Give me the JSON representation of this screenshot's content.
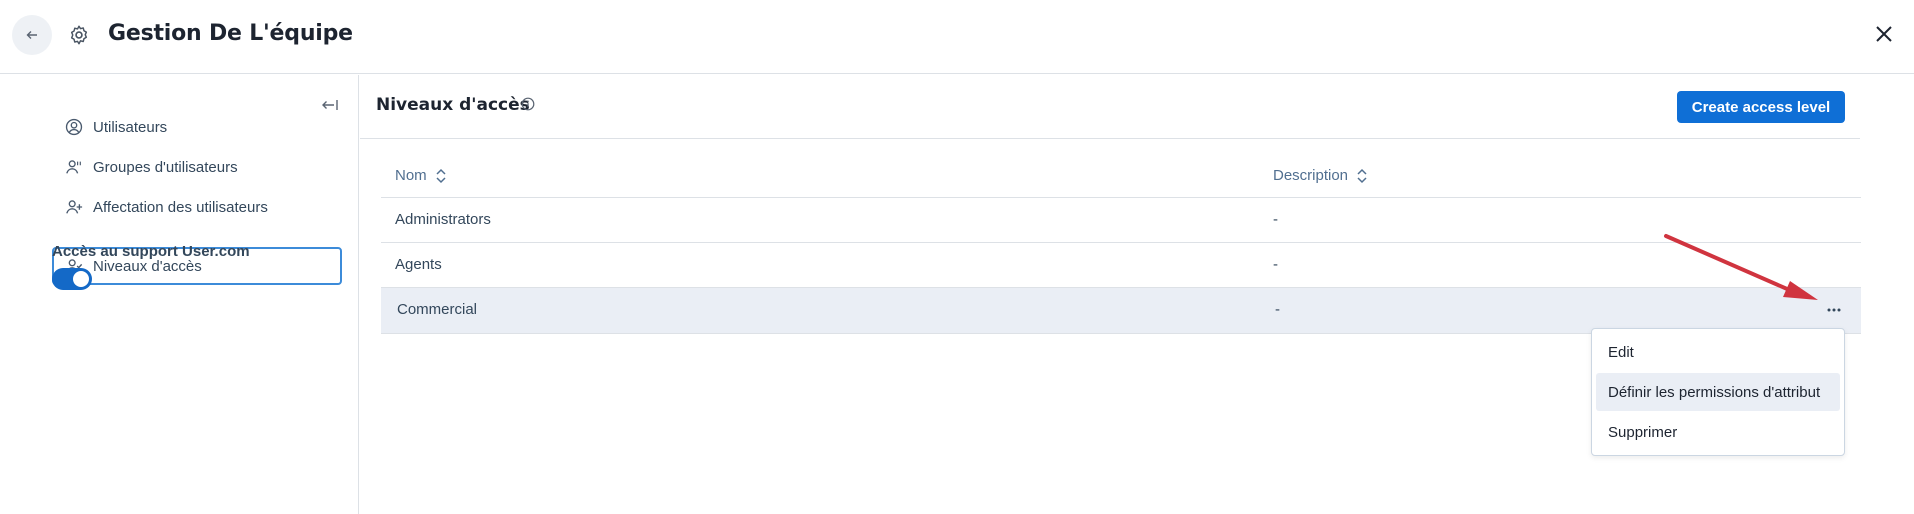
{
  "header": {
    "title": "Gestion De L'équipe",
    "back_icon": "arrow-left-icon",
    "settings_icon": "gear-icon",
    "close_icon": "close-icon"
  },
  "sidebar": {
    "items": [
      {
        "label": "Utilisateurs",
        "icon": "user-circle-icon"
      },
      {
        "label": "Groupes d'utilisateurs",
        "icon": "user-group-icon"
      },
      {
        "label": "Affectation des utilisateurs",
        "icon": "user-plus-icon"
      },
      {
        "label": "Niveaux d'accès",
        "icon": "user-check-icon",
        "active": true
      }
    ],
    "support_label": "Accès au support User.com",
    "support_toggle_on": true
  },
  "main": {
    "section_title": "Niveaux d'accès",
    "create_button": "Create access level",
    "table": {
      "columns": [
        "Nom",
        "Description"
      ],
      "rows": [
        {
          "name": "Administrators",
          "description": "-"
        },
        {
          "name": "Agents",
          "description": "-"
        },
        {
          "name": "Commercial",
          "description": "-"
        }
      ]
    },
    "row_menu": {
      "items": [
        "Edit",
        "Définir les permissions d'attribut",
        "Supprimer"
      ],
      "hovered": "Définir les permissions d'attribut"
    }
  },
  "colors": {
    "accent": "#0f6fd6",
    "annotation_arrow": "#d0343f"
  }
}
